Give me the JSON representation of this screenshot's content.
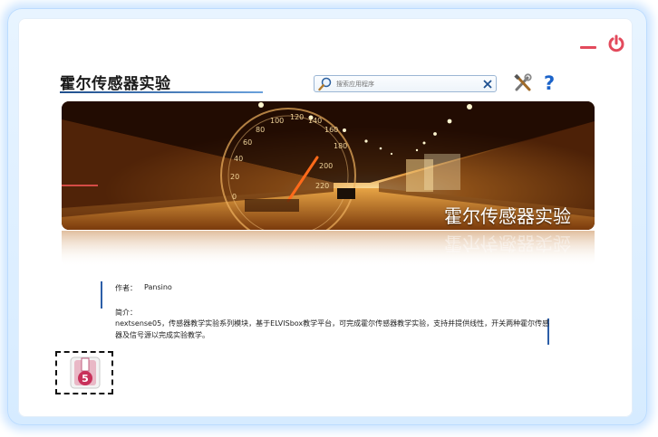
{
  "window": {
    "minimize_icon": "minimize-icon",
    "power_icon": "power-icon",
    "accent_color": "#e34a5c"
  },
  "header": {
    "title": "霍尔传感器实验"
  },
  "search": {
    "placeholder": "搜索应用程序",
    "search_icon": "magnifier-icon",
    "clear_icon": "close-icon"
  },
  "toolbar": {
    "tools_icon": "tools-icon",
    "help_label": "?"
  },
  "banner": {
    "caption": "霍尔传感器实验"
  },
  "info": {
    "author_label": "作者：",
    "author_name": "Pansino",
    "description_label": "简介：",
    "description_text": "nextsense05，传感器教学实验系列模块，基于ELVISbox教学平台，可完成霍尔传感器教学实验，支持并提供线性，开关两种霍尔传感器及信号源以完成实验教学。"
  },
  "app_tile": {
    "badge": "5",
    "icon": "app-module-icon"
  }
}
